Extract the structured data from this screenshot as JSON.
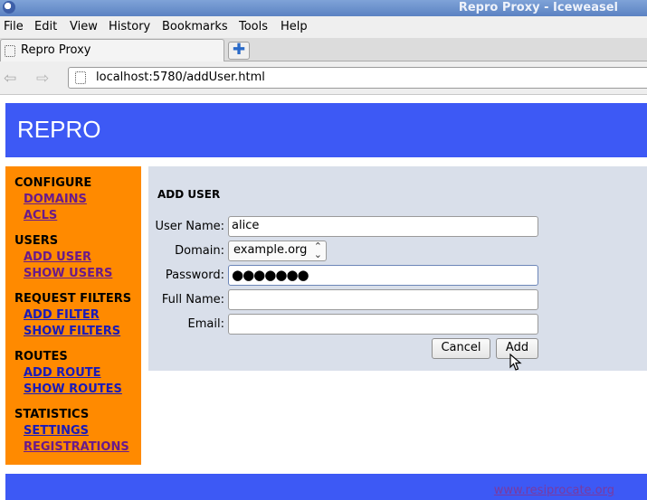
{
  "window": {
    "title": "Repro Proxy - Iceweasel"
  },
  "menubar": {
    "items": [
      "File",
      "Edit",
      "View",
      "History",
      "Bookmarks",
      "Tools",
      "Help"
    ]
  },
  "tabs": [
    {
      "label": "Repro Proxy"
    }
  ],
  "navbar": {
    "url": "localhost:5780/addUser.html"
  },
  "page": {
    "brand": "REPRO",
    "sidebar": {
      "sections": [
        {
          "title": "CONFIGURE",
          "links": [
            "DOMAINS",
            "ACLS"
          ]
        },
        {
          "title": "USERS",
          "links": [
            "ADD USER",
            "SHOW USERS"
          ]
        },
        {
          "title": "REQUEST FILTERS",
          "links": [
            "ADD FILTER",
            "SHOW FILTERS"
          ]
        },
        {
          "title": "ROUTES",
          "links": [
            "ADD ROUTE",
            "SHOW ROUTES"
          ]
        },
        {
          "title": "STATISTICS",
          "links": [
            "SETTINGS",
            "REGISTRATIONS"
          ]
        }
      ]
    },
    "form": {
      "title": "ADD USER",
      "user_name_label": "User Name:",
      "user_name_value": "alice",
      "domain_label": "Domain:",
      "domain_value": "example.org",
      "password_label": "Password:",
      "password_value": "●●●●●●●",
      "full_name_label": "Full Name:",
      "full_name_value": "",
      "email_label": "Email:",
      "email_value": "",
      "cancel_label": "Cancel",
      "add_label": "Add"
    },
    "footer": {
      "link": "www.resiprocate.org"
    }
  },
  "colors": {
    "header_blue": "#3d59f5",
    "sidebar_orange": "#ff8a00",
    "panel_grey": "#d9dfea"
  }
}
